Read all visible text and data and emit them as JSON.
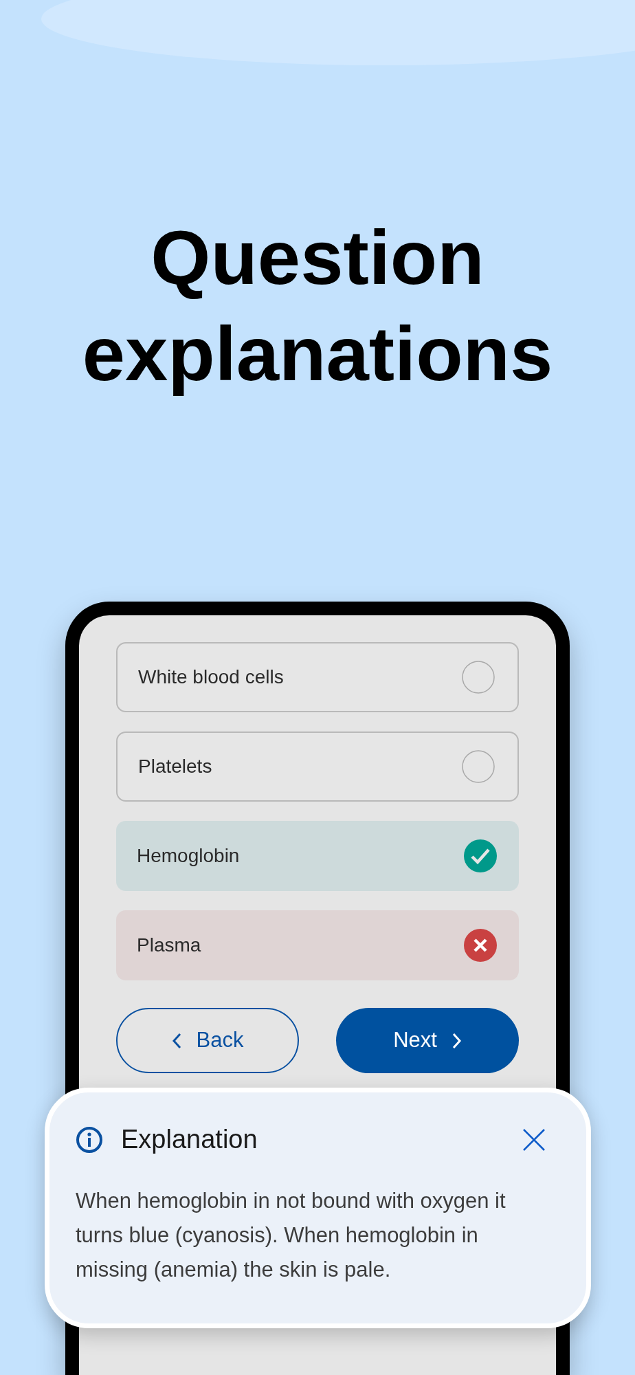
{
  "headline": "Question explanations",
  "options": [
    {
      "label": "White blood cells",
      "kind": "unmarked"
    },
    {
      "label": "Platelets",
      "kind": "unmarked"
    },
    {
      "label": "Hemoglobin",
      "kind": "correct"
    },
    {
      "label": "Plasma",
      "kind": "wrong"
    }
  ],
  "buttons": {
    "back": "Back",
    "next": "Next"
  },
  "explanation": {
    "title": "Explanation",
    "text": "When hemoglobin in not bound with oxygen it turns blue (cyanosis). When hemoglobin in missing (anemia) the skin is pale."
  }
}
